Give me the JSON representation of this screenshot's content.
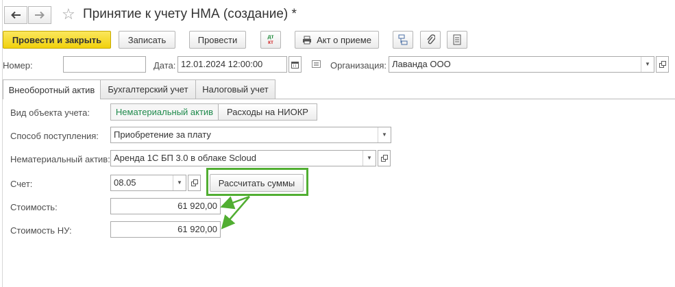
{
  "window": {
    "title": "Принятие к учету НМА (создание) *"
  },
  "toolbar": {
    "post_and_close": "Провести и закрыть",
    "save": "Записать",
    "post": "Провести",
    "dt_kt_top": "дт",
    "dt_kt_bottom": "кт",
    "act": "Акт о приеме"
  },
  "header": {
    "number_label": "Номер:",
    "number_value": "",
    "date_label": "Дата:",
    "date_value": "12.01.2024 12:00:00",
    "org_label": "Организация:",
    "org_value": "Лаванда ООО"
  },
  "tabs": [
    {
      "label": "Внеоборотный актив"
    },
    {
      "label": "Бухгалтерский учет"
    },
    {
      "label": "Налоговый учет"
    }
  ],
  "form": {
    "object_type_label": "Вид объекта учета:",
    "object_type_options": [
      "Нематериальный актив",
      "Расходы на НИОКР"
    ],
    "receipt_label": "Способ поступления:",
    "receipt_value": "Приобретение за плату",
    "asset_label": "Нематериальный актив:",
    "asset_value": "Аренда 1С БП 3.0 в облаке Scloud",
    "account_label": "Счет:",
    "account_value": "08.05",
    "calc_button": "Рассчитать суммы",
    "cost_label": "Стоимость:",
    "cost_value": "61 920,00",
    "tax_cost_label": "Стоимость НУ:",
    "tax_cost_value": "61 920,00"
  },
  "colors": {
    "primary": "#f4d21d",
    "annotation": "#51ae32",
    "selected_option": "#1f8a4c"
  },
  "icons": [
    "back-arrow-icon",
    "forward-arrow-icon",
    "favorite-star-icon",
    "print-icon",
    "structure-icon",
    "attachment-icon",
    "report-icon",
    "calendar-icon",
    "document-icon",
    "chevron-down-icon",
    "open-icon"
  ]
}
